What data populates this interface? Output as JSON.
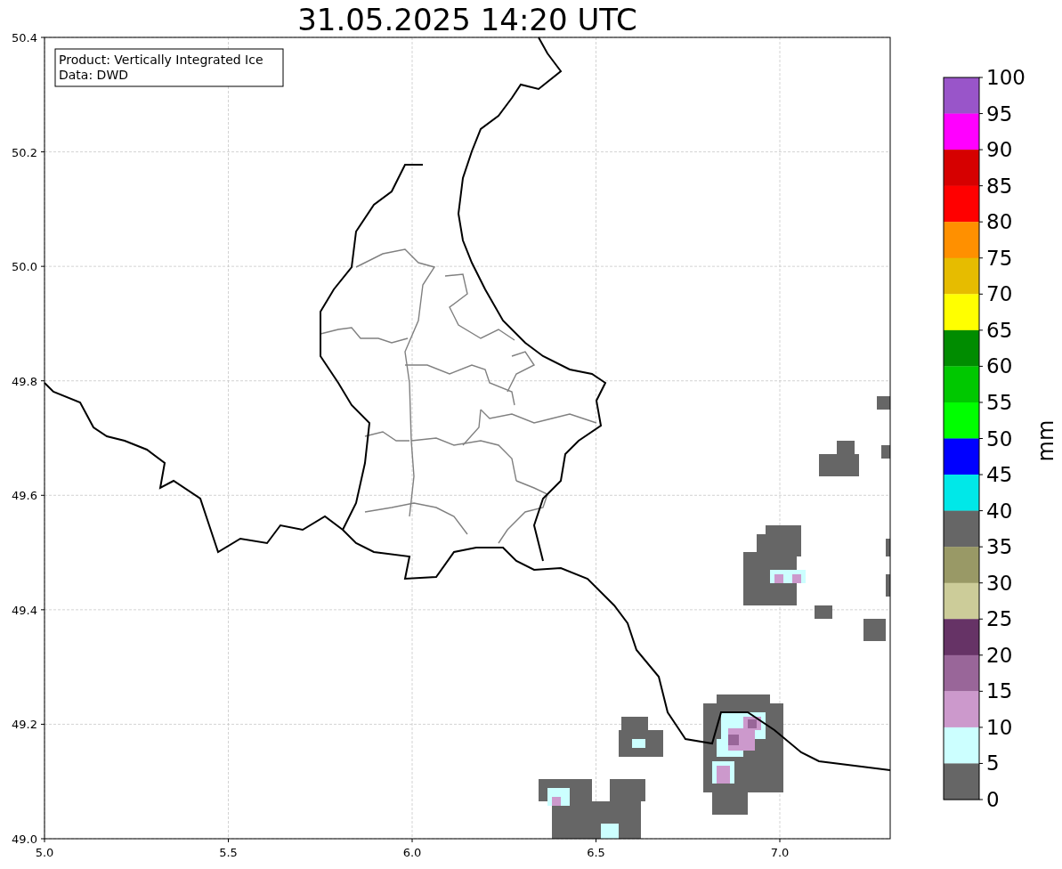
{
  "title": "31.05.2025 14:20 UTC",
  "info_box": [
    "Product: Vertically Integrated Ice",
    "Data: DWD"
  ],
  "x_ticks": [
    "5.0",
    "5.5",
    "6.0",
    "6.5",
    "7.0"
  ],
  "y_ticks": [
    "50.4",
    "50.2",
    "50.0",
    "49.8",
    "49.6",
    "49.4",
    "49.2",
    "49.0"
  ],
  "colorbar": {
    "unit": "mm",
    "segments": [
      {
        "color": "#9955c9"
      },
      {
        "color": "#ff00ff"
      },
      {
        "color": "#d60000"
      },
      {
        "color": "#ff0000"
      },
      {
        "color": "#ff9000"
      },
      {
        "color": "#e6bc00"
      },
      {
        "color": "#ffff00"
      },
      {
        "color": "#008c00"
      },
      {
        "color": "#00c800"
      },
      {
        "color": "#00ff00"
      },
      {
        "color": "#0000ff"
      },
      {
        "color": "#00e8e8"
      },
      {
        "color": "#666666"
      },
      {
        "color": "#999966"
      },
      {
        "color": "#cccc99"
      },
      {
        "color": "#663366"
      },
      {
        "color": "#996699"
      },
      {
        "color": "#cc99cc"
      },
      {
        "color": "#ccffff"
      },
      {
        "color": "#666666"
      }
    ],
    "labels": [
      "100",
      "95",
      "90",
      "85",
      "80",
      "75",
      "70",
      "65",
      "60",
      "55",
      "50",
      "45",
      "40",
      "35",
      "30",
      "25",
      "20",
      "15",
      "10",
      "5",
      "0"
    ]
  }
}
